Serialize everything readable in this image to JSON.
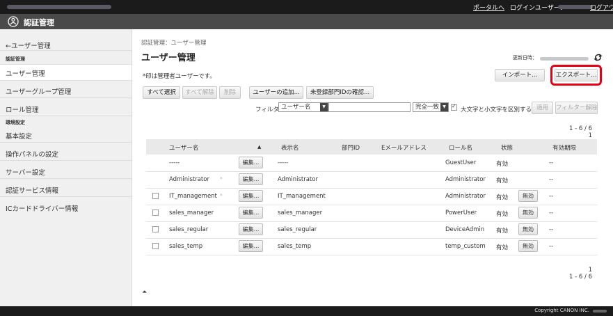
{
  "top": {
    "portal": "ポータルへ",
    "login_user_label": "ログインユーザー：",
    "logout": "ログアウト"
  },
  "app": {
    "title": "認証管理"
  },
  "sidebar": {
    "back": "←ユーザー管理",
    "section1": "認証管理",
    "items1": [
      "ユーザー管理",
      "ユーザーグループ管理",
      "ロール管理"
    ],
    "section2": "環境設定",
    "items2": [
      "基本設定",
      "操作パネルの設定",
      "サーバー設定",
      "認証サービス情報",
      "ICカードドライバー情報"
    ]
  },
  "page": {
    "breadcrumb": "認証管理：ユーザー管理",
    "title": "ユーザー管理",
    "updated_label": "更新日時：",
    "note": "*印は管理者ユーザーです。"
  },
  "buttons": {
    "import": "インポート...",
    "export": "エクスポート...",
    "select_all": "すべて選択",
    "deselect_all": "すべて解除",
    "delete": "削除",
    "add_user": "ユーザーの追加...",
    "check_dept": "未登録部門IDの確認...",
    "apply": "適用",
    "clear_filter": "フィルター解除"
  },
  "filter": {
    "label": "フィルター：",
    "field": "ユーザー名",
    "value": "",
    "match": "完全一致",
    "case_label": "大文字と小文字を区別する",
    "case_checked": true
  },
  "paging": {
    "range": "1 - 6 / 6",
    "page": "1"
  },
  "table": {
    "headers": [
      "ユーザー名",
      "▲",
      "表示名",
      "部門ID",
      "Eメールアドレス",
      "ロール名",
      "状態",
      "有効期限"
    ],
    "edit_label": "編集...",
    "disable_label": "無効",
    "rows": [
      {
        "user": "-----",
        "admin": false,
        "display": "-----",
        "dept": "",
        "email": "",
        "role": "GuestUser",
        "status": "有効",
        "expiry": "--",
        "checkbox": false,
        "disable": false
      },
      {
        "user": "Administrator",
        "admin": true,
        "display": "Administrator",
        "dept": "",
        "email": "",
        "role": "Administrator",
        "status": "有効",
        "expiry": "--",
        "checkbox": false,
        "disable": false
      },
      {
        "user": "IT_management",
        "admin": true,
        "display": "IT_management",
        "dept": "",
        "email": "",
        "role": "Administrator",
        "status": "有効",
        "expiry": "--",
        "checkbox": true,
        "disable": true
      },
      {
        "user": "sales_manager",
        "admin": false,
        "display": "sales_manager",
        "dept": "",
        "email": "",
        "role": "PowerUser",
        "status": "有効",
        "expiry": "--",
        "checkbox": true,
        "disable": true
      },
      {
        "user": "sales_regular",
        "admin": false,
        "display": "sales_regular",
        "dept": "",
        "email": "",
        "role": "DeviceAdmin",
        "status": "有効",
        "expiry": "--",
        "checkbox": true,
        "disable": true
      },
      {
        "user": "sales_temp",
        "admin": false,
        "display": "sales_temp",
        "dept": "",
        "email": "",
        "role": "temp_custom",
        "status": "有効",
        "expiry": "--",
        "checkbox": true,
        "disable": true
      }
    ]
  },
  "footer": {
    "copyright": "Copyright CANON INC."
  },
  "icons": {
    "refresh": "refresh-icon",
    "to_top": "to-top-icon",
    "app": "auth-app-icon"
  },
  "colors": {
    "highlight": "#e60012",
    "topbar": "#1b1b1b",
    "titlebar": "#4a4a4a"
  }
}
